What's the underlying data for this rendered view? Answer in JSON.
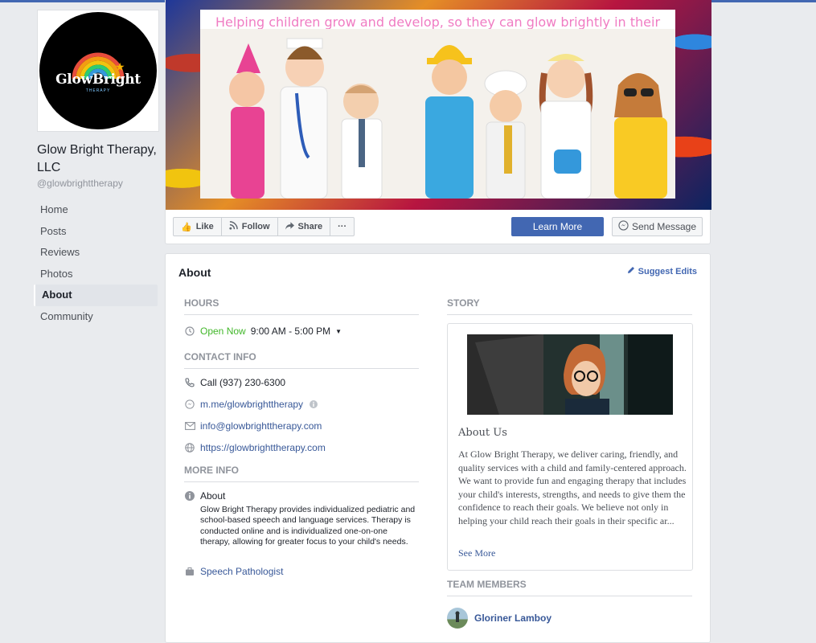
{
  "page": {
    "name": "Glow Bright Therapy, LLC",
    "handle": "@glowbrighttherapy",
    "logo_text": "GlowBright",
    "logo_subtext": "THERAPY"
  },
  "nav": {
    "items": [
      {
        "label": "Home"
      },
      {
        "label": "Posts"
      },
      {
        "label": "Reviews"
      },
      {
        "label": "Photos"
      },
      {
        "label": "About",
        "active": true
      },
      {
        "label": "Community"
      }
    ]
  },
  "cover": {
    "caption": "Helping children grow and develop, so they can glow brightly in their future!"
  },
  "actions": {
    "like": "Like",
    "follow": "Follow",
    "share": "Share",
    "more": "···",
    "learn_more": "Learn More",
    "send_message": "Send Message"
  },
  "about": {
    "title": "About",
    "suggest_edits": "Suggest Edits",
    "hours_heading": "HOURS",
    "open_status": "Open Now",
    "hours": "9:00 AM - 5:00 PM",
    "contact_heading": "CONTACT INFO",
    "phone": "Call (937) 230-6300",
    "messenger": "m.me/glowbrighttherapy",
    "email": "info@glowbrighttherapy.com",
    "website": "https://glowbrighttherapy.com",
    "more_heading": "MORE INFO",
    "about_label": "About",
    "about_text": "Glow Bright Therapy provides individualized pediatric and school-based speech and language services. Therapy is conducted online and is individualized one-on-one therapy, allowing for greater focus to your child's needs.",
    "category": "Speech Pathologist"
  },
  "story": {
    "heading": "STORY",
    "title": "About Us",
    "text": "At Glow Bright Therapy, we deliver caring, friendly, and quality services with a child and family-centered approach. We want to provide fun and engaging therapy that includes your child's interests, strengths, and needs to give them the confidence to reach their goals. We believe not only in helping your child reach their goals in their specific ar...",
    "see_more": "See More"
  },
  "team": {
    "heading": "TEAM MEMBERS",
    "members": [
      {
        "name": "Gloriner Lamboy"
      }
    ]
  }
}
